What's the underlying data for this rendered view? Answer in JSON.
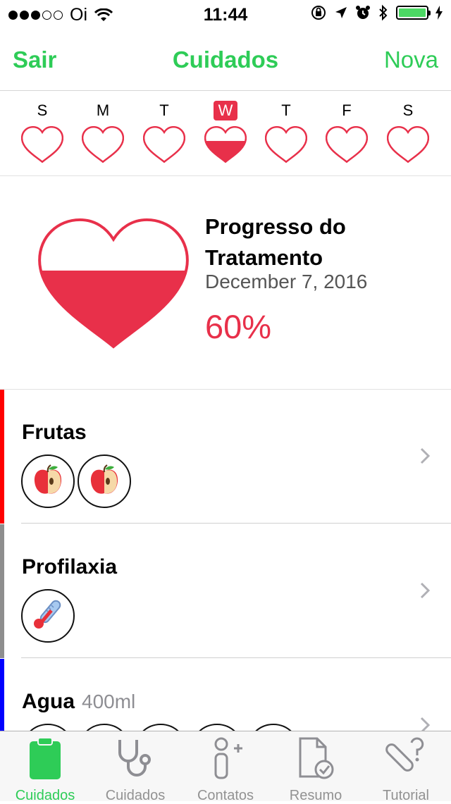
{
  "status_bar": {
    "carrier": "Oi",
    "time": "11:44"
  },
  "nav": {
    "left_label": "Sair",
    "title": "Cuidados",
    "right_label": "Nova"
  },
  "week": {
    "days": [
      {
        "letter": "S",
        "fill": 0
      },
      {
        "letter": "M",
        "fill": 0
      },
      {
        "letter": "T",
        "fill": 0
      },
      {
        "letter": "W",
        "fill": 0.6,
        "selected": true
      },
      {
        "letter": "T",
        "fill": 0
      },
      {
        "letter": "F",
        "fill": 0
      },
      {
        "letter": "S",
        "fill": 0
      }
    ]
  },
  "progress": {
    "title": "Progresso do Tratamento",
    "date": "December 7, 2016",
    "percent_label": "60%",
    "fill": 0.6
  },
  "cares": [
    {
      "title": "Frutas",
      "subtitle": "",
      "color": "#ff0000",
      "icon": "apple-icon",
      "count": 2
    },
    {
      "title": "Profilaxia",
      "subtitle": "",
      "color": "#8e8e8e",
      "icon": "thermometer-icon",
      "count": 1
    },
    {
      "title": "Agua",
      "subtitle": "400ml",
      "color": "#0000ff",
      "icon": "water-icon",
      "count": 5
    }
  ],
  "tabs": [
    {
      "label": "Cuidados",
      "icon": "clipboard-icon",
      "active": true
    },
    {
      "label": "Cuidados",
      "icon": "stethoscope-icon",
      "active": false
    },
    {
      "label": "Contatos",
      "icon": "person-add-icon",
      "active": false
    },
    {
      "label": "Resumo",
      "icon": "document-check-icon",
      "active": false
    },
    {
      "label": "Tutorial",
      "icon": "thermometer-question-icon",
      "active": false
    }
  ],
  "colors": {
    "accent_green": "#2ecc57",
    "heart_red": "#e8304a"
  }
}
